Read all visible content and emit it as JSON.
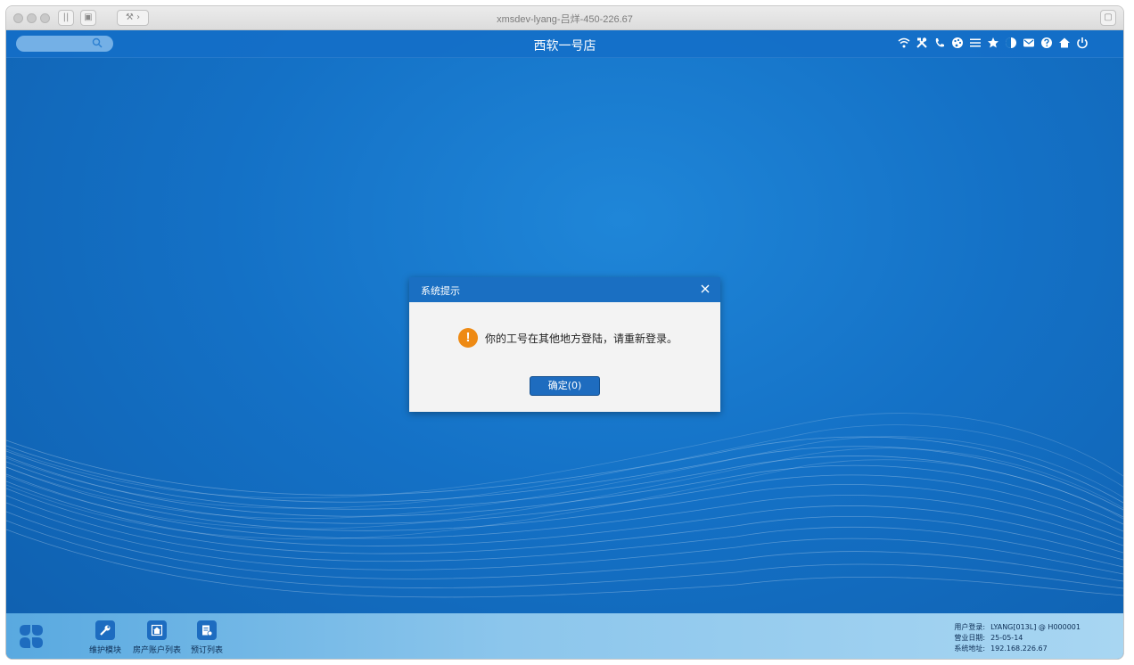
{
  "window": {
    "title": "xmsdev-lyang-吕烊-450-226.67"
  },
  "header": {
    "store_name": "西软一号店",
    "search": {
      "placeholder": ""
    },
    "tools": [
      "wifi-icon",
      "tools-icon",
      "phone-icon",
      "palette-icon",
      "list-icon",
      "star-icon",
      "contrast-icon",
      "mail-icon",
      "help-icon",
      "home-icon",
      "power-icon"
    ]
  },
  "dialog": {
    "title": "系统提示",
    "message": "你的工号在其他地方登陆，请重新登录。",
    "ok_label": "确定(0)"
  },
  "dock": {
    "items": [
      {
        "label": "维护模块",
        "icon": "wrench-icon"
      },
      {
        "label": "房产账户列表",
        "icon": "house-icon"
      },
      {
        "label": "预订列表",
        "icon": "document-icon"
      }
    ]
  },
  "status": {
    "user_label": "用户登录:",
    "user_value": "LYANG[013L] @ H000001",
    "date_label": "营业日期:",
    "date_value": "25-05-14",
    "addr_label": "系统地址:",
    "addr_value": "192.168.226.67"
  },
  "colors": {
    "accent": "#1a6fc2",
    "warning": "#ee8a14",
    "background": "#1471c6"
  }
}
